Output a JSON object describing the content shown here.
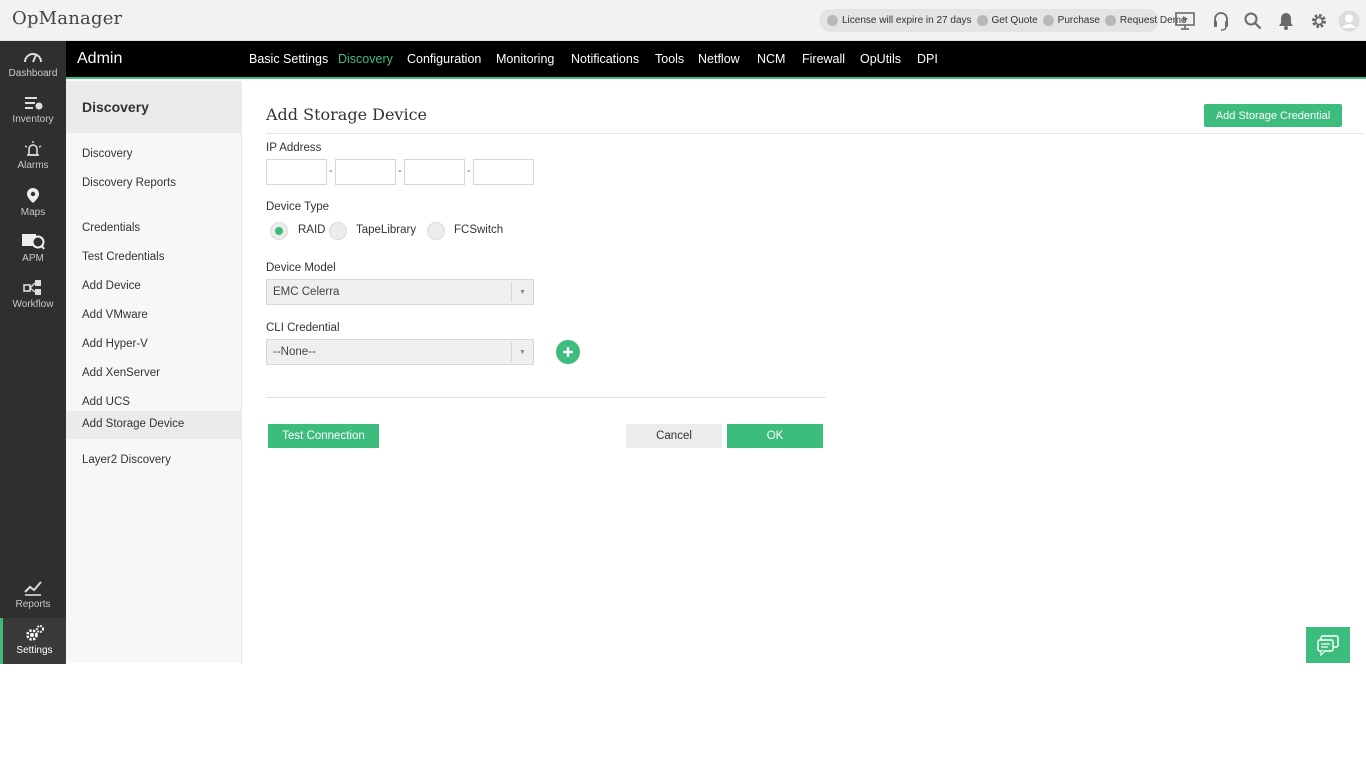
{
  "app": {
    "title": "OpManager"
  },
  "topbar": {
    "license_text": "License will expire in 27 days",
    "get_quote": "Get Quote",
    "purchase": "Purchase",
    "request_demo": "Request Demo",
    "icons": [
      "presentation-icon",
      "headset-icon",
      "search-icon",
      "bell-icon",
      "gear-icon",
      "user-avatar-icon"
    ]
  },
  "leftnav": {
    "items": [
      {
        "label": "Dashboard",
        "icon": "speedometer-icon"
      },
      {
        "label": "Inventory",
        "icon": "inventory-icon"
      },
      {
        "label": "Alarms",
        "icon": "alarm-icon"
      },
      {
        "label": "Maps",
        "icon": "map-pin-icon"
      },
      {
        "label": "APM",
        "icon": "apm-icon"
      },
      {
        "label": "Workflow",
        "icon": "workflow-icon"
      },
      {
        "label": "Reports",
        "icon": "reports-chart-icon"
      },
      {
        "label": "Settings",
        "icon": "settings-gears-icon"
      }
    ],
    "active": "Settings"
  },
  "adminbar": {
    "title": "Admin",
    "tabs": [
      "Basic Settings",
      "Discovery",
      "Configuration",
      "Monitoring",
      "Notifications",
      "Tools",
      "Netflow",
      "NCM",
      "Firewall",
      "OpUtils",
      "DPI"
    ],
    "active_tab": "Discovery"
  },
  "subsidebar": {
    "header": "Discovery",
    "group1": [
      "Discovery",
      "Discovery Reports"
    ],
    "group2": [
      "Credentials",
      "Test Credentials",
      "Add Device",
      "Add VMware",
      "Add Hyper-V",
      "Add XenServer",
      "Add UCS",
      "Add Storage Device",
      "Layer2 Discovery"
    ],
    "active": "Add Storage Device"
  },
  "form": {
    "title": "Add Storage Device",
    "add_credential_label": "Add Storage Credential",
    "ip_label": "IP Address",
    "ip_octets": [
      "",
      "",
      "",
      ""
    ],
    "ip_separator": "-",
    "device_type_label": "Device Type",
    "device_types": [
      "RAID",
      "TapeLibrary",
      "FCSwitch"
    ],
    "device_type_selected": "RAID",
    "device_model_label": "Device Model",
    "device_model_value": "EMC Celerra",
    "cli_label": "CLI Credential",
    "cli_value": "--None--",
    "test_connection": "Test Connection",
    "cancel": "Cancel",
    "ok": "OK"
  },
  "colors": {
    "accent": "#3dbd7d",
    "nav_bg": "#2f2f2f",
    "admin_bg": "#000000"
  }
}
